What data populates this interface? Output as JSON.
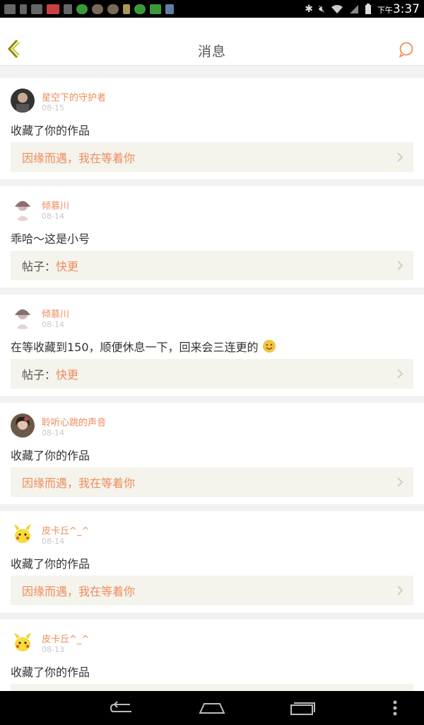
{
  "status_bar": {
    "time_prefix": "下午",
    "time": "3:37"
  },
  "app_bar": {
    "title": "消息"
  },
  "colors": {
    "accent": "#ee8c5b",
    "card_link_bg": "#f4f3ec"
  },
  "messages": [
    {
      "user": "星空下的守护者",
      "date": "08-15",
      "text": "收藏了你的作品",
      "link_prefix": "",
      "link_text": "因缘而遇，我在等着你",
      "avatar": "dark-avatar"
    },
    {
      "user": "倾慕川",
      "date": "08-14",
      "text": "乖哈～这是小号",
      "link_prefix": "帖子：",
      "link_text": "快更",
      "avatar": "girl-avatar"
    },
    {
      "user": "倾慕川",
      "date": "08-14",
      "text": "在等收藏到150，顺便休息一下，回来会三连更的",
      "link_prefix": "帖子：",
      "link_text": "快更",
      "avatar": "girl-avatar",
      "emoji": "smile-emoji"
    },
    {
      "user": "聆听心跳的声音",
      "date": "08-14",
      "text": "收藏了你的作品",
      "link_prefix": "",
      "link_text": "因缘而遇，我在等着你",
      "avatar": "portrait-avatar"
    },
    {
      "user": "皮卡丘^_^",
      "date": "08-14",
      "text": "收藏了你的作品",
      "link_prefix": "",
      "link_text": "因缘而遇，我在等着你",
      "avatar": "pikachu-avatar"
    },
    {
      "user": "皮卡丘^_^",
      "date": "08-13",
      "text": "收藏了你的作品",
      "link_prefix": "",
      "link_text": "",
      "avatar": "pikachu-avatar"
    }
  ]
}
